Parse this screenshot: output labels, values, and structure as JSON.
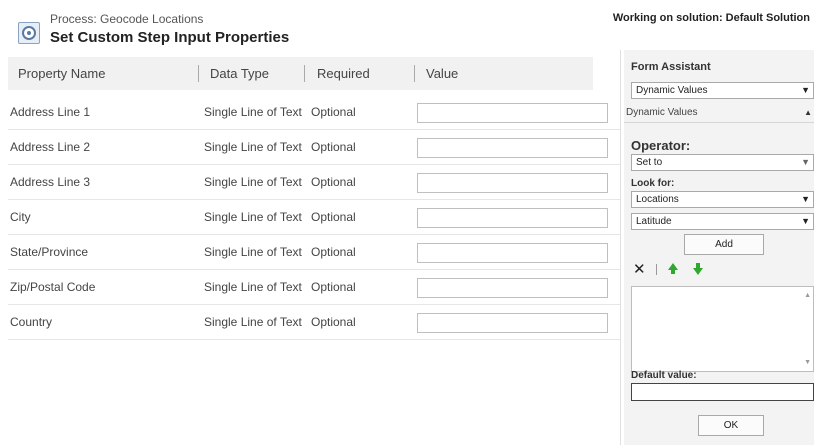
{
  "header": {
    "process_label": "Process: Geocode Locations",
    "title": "Set Custom Step Input Properties",
    "solution": "Working on solution: Default Solution"
  },
  "grid": {
    "columns": [
      "Property Name",
      "Data Type",
      "Required",
      "Value"
    ],
    "rows": [
      {
        "name": "Address Line 1",
        "type": "Single Line of Text",
        "required": "Optional",
        "value": ""
      },
      {
        "name": "Address Line 2",
        "type": "Single Line of Text",
        "required": "Optional",
        "value": ""
      },
      {
        "name": "Address Line 3",
        "type": "Single Line of Text",
        "required": "Optional",
        "value": ""
      },
      {
        "name": "City",
        "type": "Single Line of Text",
        "required": "Optional",
        "value": ""
      },
      {
        "name": "State/Province",
        "type": "Single Line of Text",
        "required": "Optional",
        "value": ""
      },
      {
        "name": "Zip/Postal Code",
        "type": "Single Line of Text",
        "required": "Optional",
        "value": ""
      },
      {
        "name": "Country",
        "type": "Single Line of Text",
        "required": "Optional",
        "value": ""
      }
    ]
  },
  "form_assistant": {
    "title": "Form Assistant",
    "mode_select": "Dynamic Values",
    "section_label": "Dynamic Values",
    "operator_label": "Operator:",
    "operator_value": "Set to",
    "look_for_label": "Look for:",
    "look_for_entity": "Locations",
    "look_for_field": "Latitude",
    "add_label": "Add",
    "default_value_label": "Default value:",
    "default_value": "",
    "ok_label": "OK"
  }
}
